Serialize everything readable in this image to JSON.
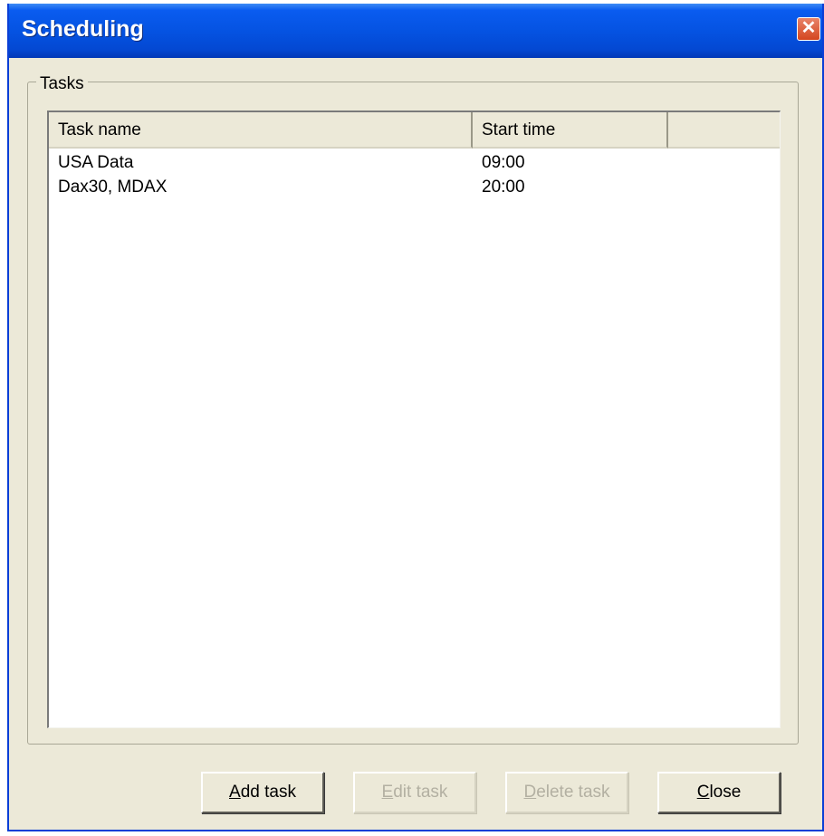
{
  "window": {
    "title": "Scheduling"
  },
  "titlebar": {
    "close_glyph": "✕",
    "close_icon": "close-icon"
  },
  "tasks_group": {
    "label": "Tasks"
  },
  "listview": {
    "columns": [
      "Task name",
      "Start time",
      ""
    ],
    "rows": [
      {
        "name": "USA Data",
        "start": "09:00"
      },
      {
        "name": "Dax30, MDAX",
        "start": "20:00"
      }
    ]
  },
  "buttons": {
    "add": {
      "mnemonic": "A",
      "rest": "dd task",
      "enabled": true
    },
    "edit": {
      "mnemonic": "E",
      "rest": "dit task",
      "enabled": false
    },
    "delete": {
      "mnemonic": "D",
      "rest": "elete task",
      "enabled": false
    },
    "close": {
      "mnemonic": "C",
      "rest": "lose",
      "enabled": true
    }
  },
  "colors": {
    "titlebar": "#0553e2",
    "face": "#ece9d8",
    "disabled_text": "#b3b0a2"
  }
}
